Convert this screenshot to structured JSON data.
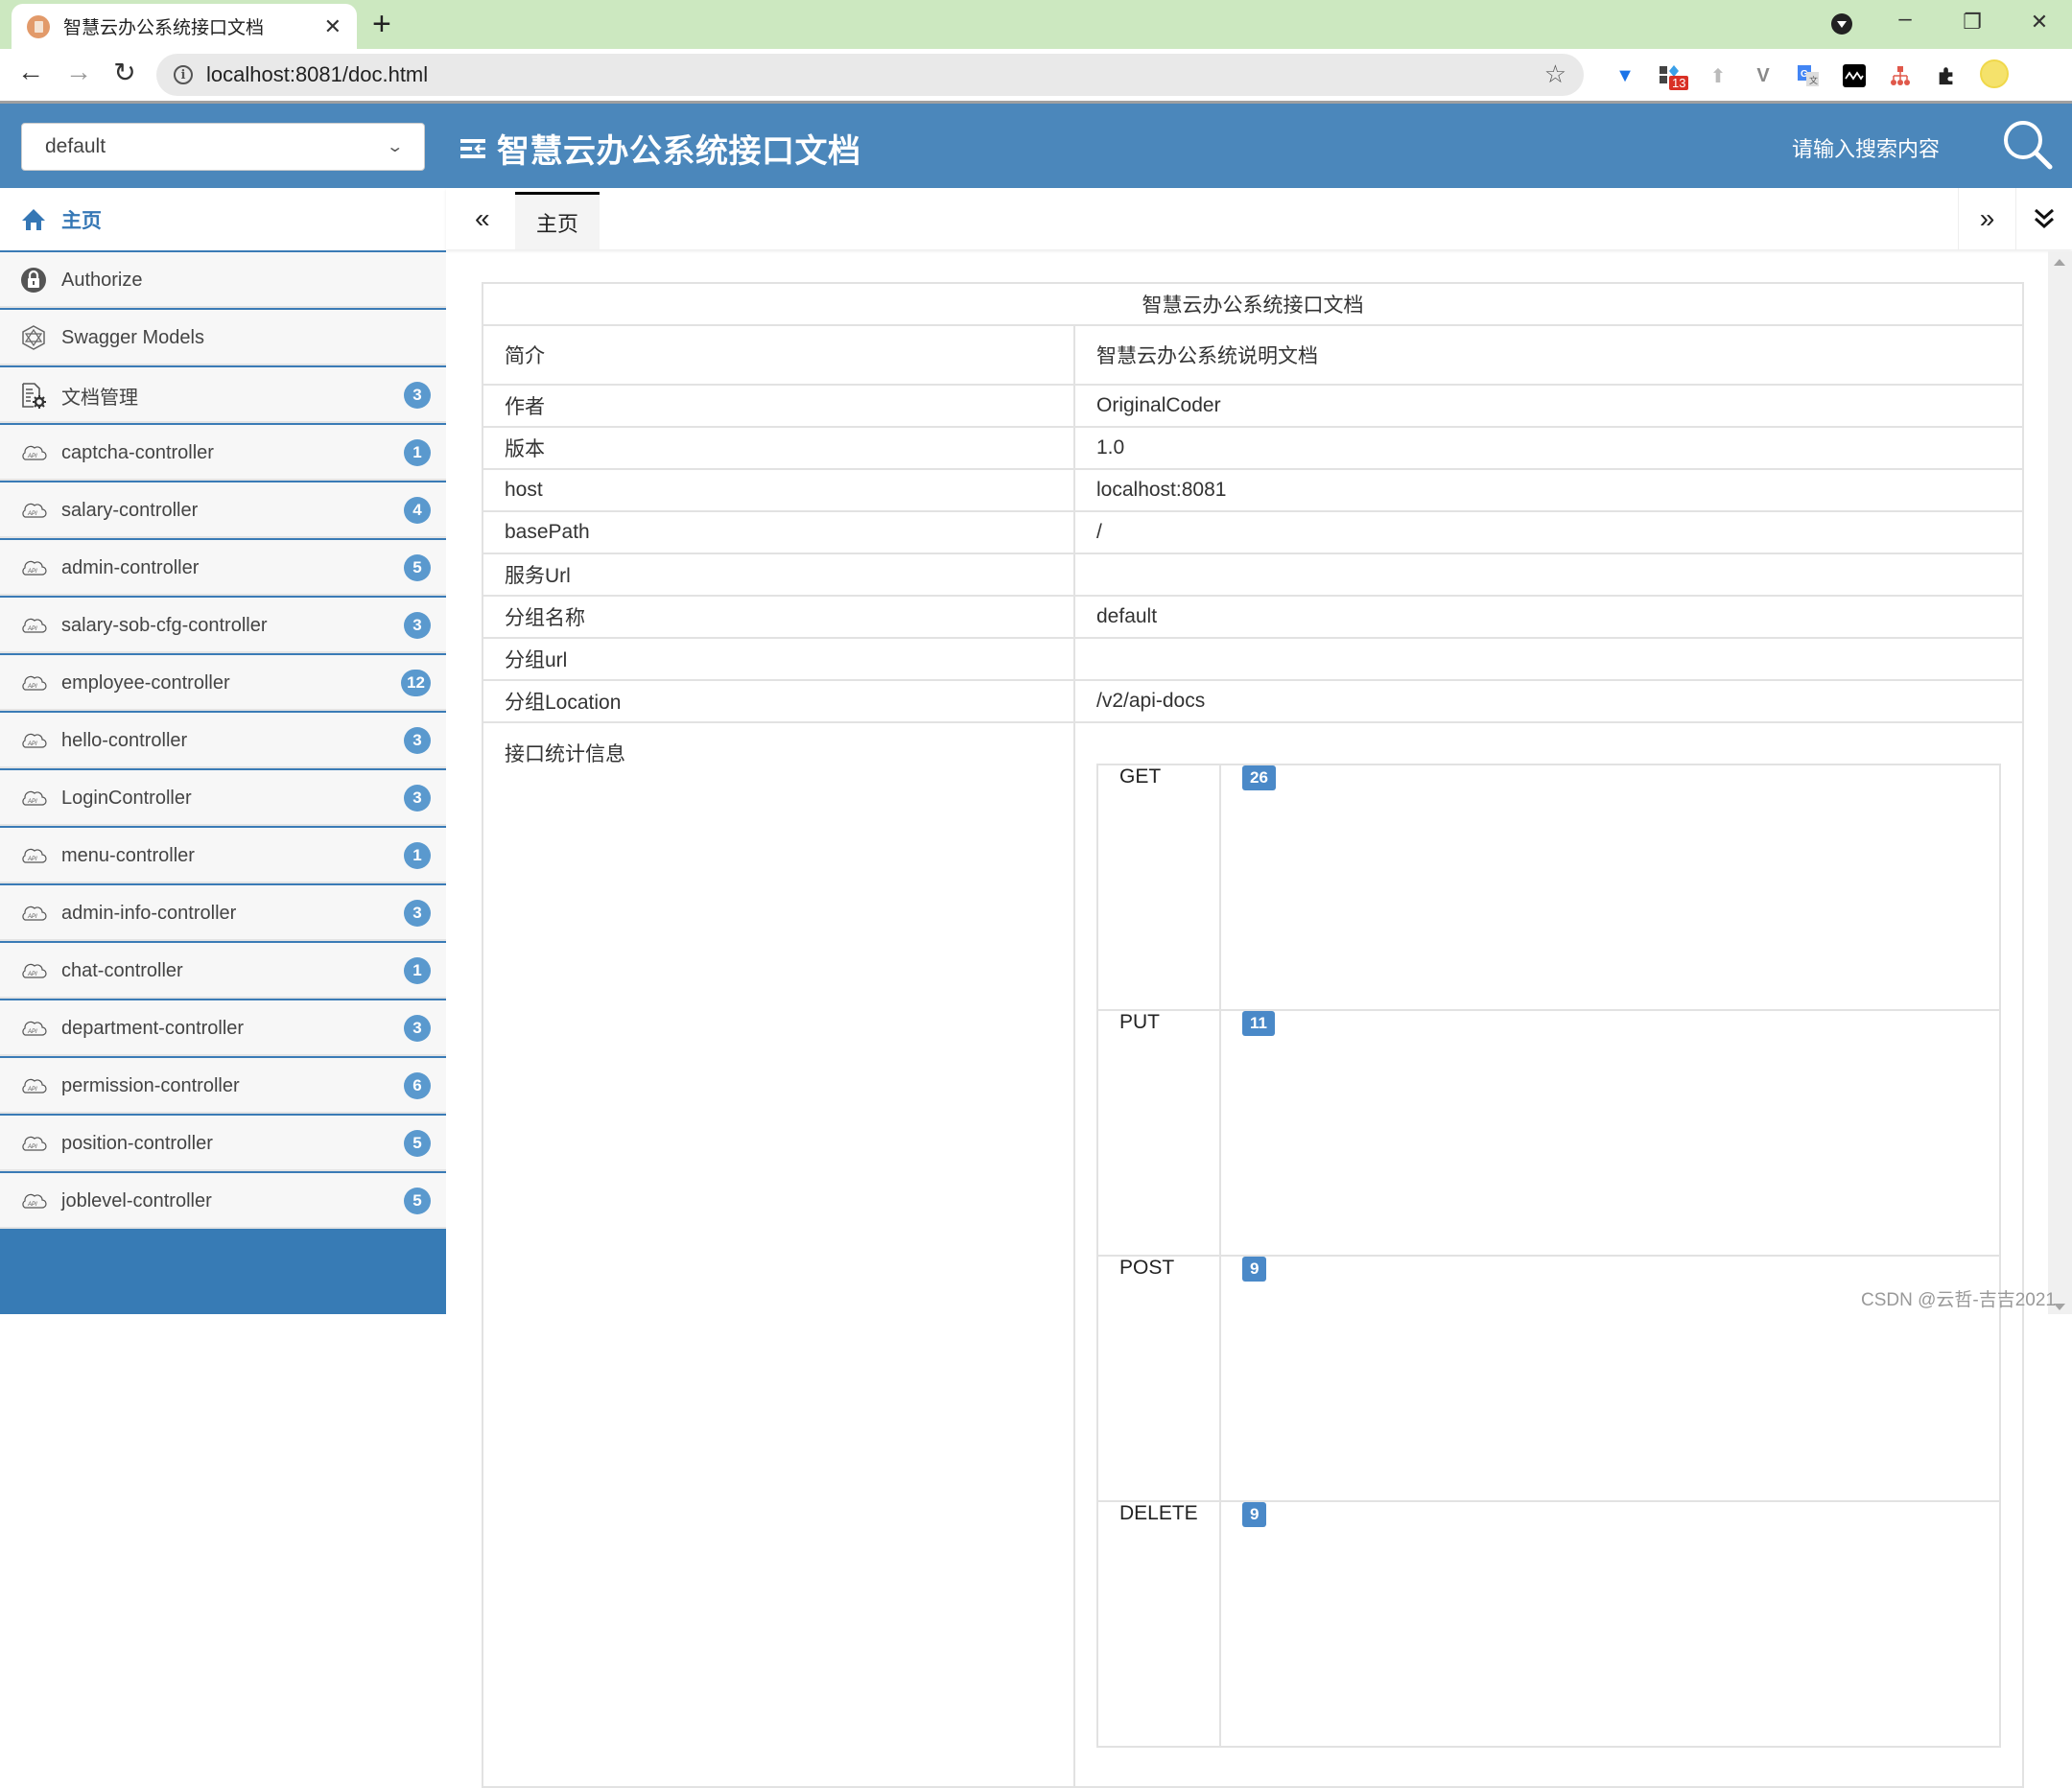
{
  "browser": {
    "tab_title": "智慧云办公系统接口文档",
    "close_glyph": "✕",
    "newtab_glyph": "+",
    "url": "localhost:8081/doc.html",
    "back_glyph": "←",
    "forward_glyph": "→",
    "reload_glyph": "↻",
    "star_glyph": "☆",
    "minimize_glyph": "–",
    "restore_glyph": "❐",
    "close_window_glyph": "✕",
    "extension_badge": "13",
    "kebab_glyph": "⋮",
    "extensions": [
      "pin-extension",
      "apps-extension",
      "upload-extension",
      "vue-devtools-extension",
      "google-translate-extension",
      "dark-extension",
      "sitemap-extension",
      "puzzle-extensions"
    ]
  },
  "header": {
    "group_select_value": "default",
    "title": "智慧云办公系统接口文档",
    "search_placeholder": "请输入搜索内容",
    "brand_color": "#4b87bb"
  },
  "sidebar": {
    "home_label": "主页",
    "items": [
      {
        "label": "Authorize",
        "icon": "lock-icon",
        "count": null
      },
      {
        "label": "Swagger Models",
        "icon": "models-icon",
        "count": null
      },
      {
        "label": "文档管理",
        "icon": "doc-settings-icon",
        "count": "3"
      },
      {
        "label": "captcha-controller",
        "icon": "api-cloud-icon",
        "count": "1"
      },
      {
        "label": "salary-controller",
        "icon": "api-cloud-icon",
        "count": "4"
      },
      {
        "label": "admin-controller",
        "icon": "api-cloud-icon",
        "count": "5"
      },
      {
        "label": "salary-sob-cfg-controller",
        "icon": "api-cloud-icon",
        "count": "3"
      },
      {
        "label": "employee-controller",
        "icon": "api-cloud-icon",
        "count": "12"
      },
      {
        "label": "hello-controller",
        "icon": "api-cloud-icon",
        "count": "3"
      },
      {
        "label": "LoginController",
        "icon": "api-cloud-icon",
        "count": "3"
      },
      {
        "label": "menu-controller",
        "icon": "api-cloud-icon",
        "count": "1"
      },
      {
        "label": "admin-info-controller",
        "icon": "api-cloud-icon",
        "count": "3"
      },
      {
        "label": "chat-controller",
        "icon": "api-cloud-icon",
        "count": "1"
      },
      {
        "label": "department-controller",
        "icon": "api-cloud-icon",
        "count": "3"
      },
      {
        "label": "permission-controller",
        "icon": "api-cloud-icon",
        "count": "6"
      },
      {
        "label": "position-controller",
        "icon": "api-cloud-icon",
        "count": "5"
      },
      {
        "label": "joblevel-controller",
        "icon": "api-cloud-icon",
        "count": "5"
      }
    ]
  },
  "tabs": {
    "prev_glyph": "«",
    "next_glyph": "»",
    "active_tab": "主页"
  },
  "doc_info": {
    "title": "智慧云办公系统接口文档",
    "rows": [
      {
        "key": "简介",
        "value": "智慧云办公系统说明文档"
      },
      {
        "key": "作者",
        "value": "OriginalCoder"
      },
      {
        "key": "版本",
        "value": "1.0"
      },
      {
        "key": "host",
        "value": "localhost:8081"
      },
      {
        "key": "basePath",
        "value": "/"
      },
      {
        "key": "服务Url",
        "value": ""
      },
      {
        "key": "分组名称",
        "value": "default"
      },
      {
        "key": "分组url",
        "value": ""
      },
      {
        "key": "分组Location",
        "value": "/v2/api-docs"
      }
    ],
    "stats_label": "接口统计信息",
    "stats": [
      {
        "method": "GET",
        "count": "26"
      },
      {
        "method": "PUT",
        "count": "11"
      },
      {
        "method": "POST",
        "count": "9"
      },
      {
        "method": "DELETE",
        "count": "9"
      }
    ]
  },
  "watermark": "CSDN @云哲-吉吉2021"
}
